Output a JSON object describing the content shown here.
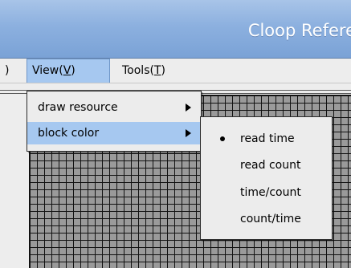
{
  "window": {
    "title": "Cloop Refere"
  },
  "menubar": {
    "prev_paren": ")",
    "view_prefix": "View(",
    "view_mnemonic": "V",
    "view_suffix": ")",
    "tools_prefix": "Tools(",
    "tools_mnemonic": "T",
    "tools_suffix": ")"
  },
  "view_menu": {
    "items": [
      {
        "label": "draw resource",
        "icon": "chevron-right-icon"
      },
      {
        "label": "block color",
        "icon": "chevron-right-icon"
      }
    ]
  },
  "block_color_menu": {
    "selected": "read time",
    "items": [
      {
        "label": "read time",
        "icon": "bullet-icon"
      },
      {
        "label": "read count"
      },
      {
        "label": "time/count"
      },
      {
        "label": "count/time"
      }
    ]
  }
}
